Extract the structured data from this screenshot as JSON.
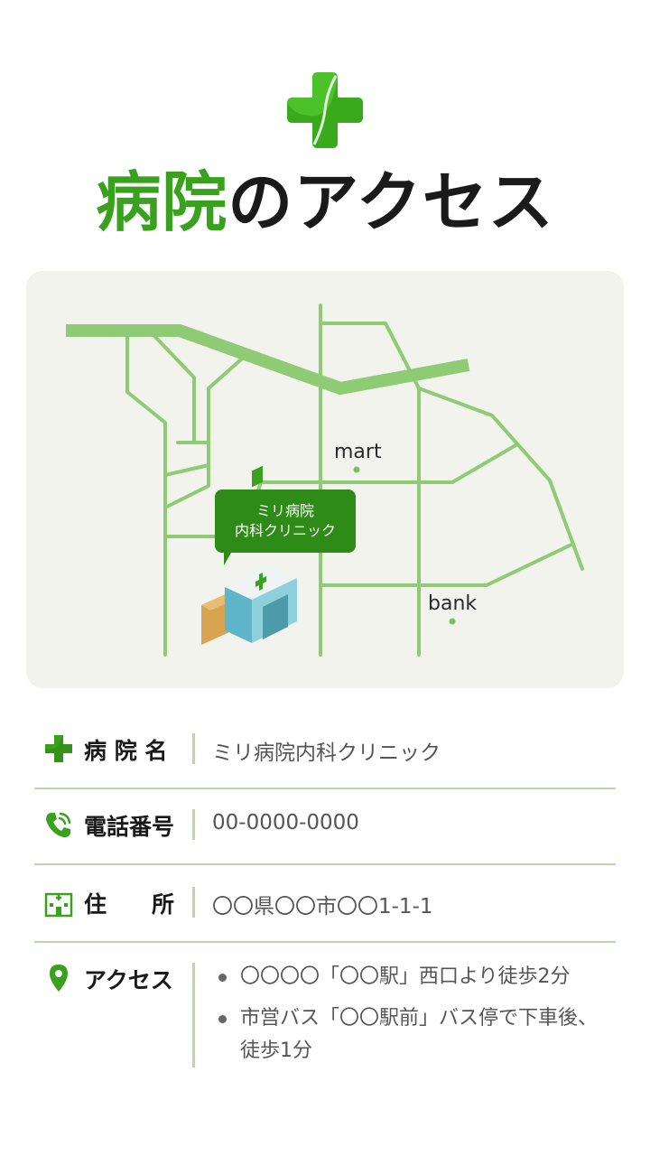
{
  "header": {
    "title_accent": "病院",
    "title_rest": "のアクセス",
    "logo_icon": "medical-cross-icon"
  },
  "map": {
    "clinic_bubble_line1": "ミリ病院",
    "clinic_bubble_line2": "内科クリニック",
    "landmark_mart": "mart",
    "landmark_bank": "bank",
    "clinic_building_icon": "clinic-building-icon"
  },
  "info": {
    "name": {
      "icon": "cross-icon",
      "label": "病 院 名",
      "value": "ミリ病院内科クリニック"
    },
    "phone": {
      "icon": "phone-icon",
      "label": "電話番号",
      "value": "00-0000-0000"
    },
    "address": {
      "icon": "hospital-icon",
      "label": "住　　所",
      "value": "〇〇県〇〇市〇〇1-1-1"
    },
    "access": {
      "icon": "location-pin-icon",
      "label": "アクセス",
      "items": [
        "〇〇〇〇「〇〇駅」西口より徒歩2分",
        "市営バス「〇〇駅前」バス停で下車後、徒歩1分"
      ]
    }
  },
  "colors": {
    "accent": "#3aa11e",
    "road": "#8fca75",
    "map_bg": "#f2f3ec",
    "bubble": "#2e8b17"
  }
}
